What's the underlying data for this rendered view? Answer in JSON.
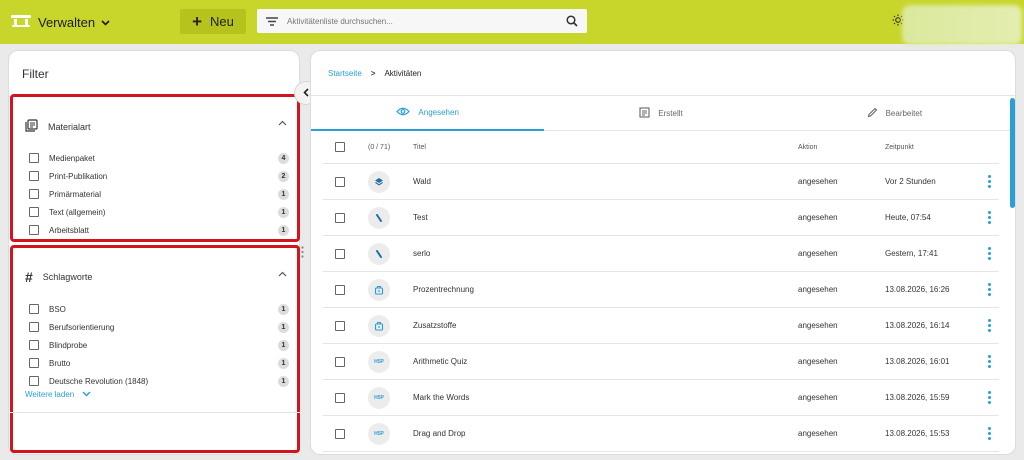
{
  "header": {
    "brand_label": "Verwalten",
    "new_button_label": "Neu",
    "search_placeholder": "Aktivitätenliste durchsuchen...",
    "accent_color": "#c8d62b"
  },
  "filter_panel": {
    "title": "Filter",
    "material_type": {
      "label": "Materialart",
      "items": [
        {
          "label": "Medienpaket",
          "count": "4"
        },
        {
          "label": "Print-Publikation",
          "count": "2"
        },
        {
          "label": "Primärmaterial",
          "count": "1"
        },
        {
          "label": "Text (allgemein)",
          "count": "1"
        },
        {
          "label": "Arbeitsblatt",
          "count": "1"
        }
      ]
    },
    "keywords": {
      "label": "Schlagworte",
      "items": [
        {
          "label": "BSO",
          "count": "1"
        },
        {
          "label": "Berufsorientierung",
          "count": "1"
        },
        {
          "label": "Blindprobe",
          "count": "1"
        },
        {
          "label": "Brutto",
          "count": "1"
        },
        {
          "label": "Deutsche Revolution (1848)",
          "count": "1"
        }
      ],
      "load_more": "Weitere laden"
    }
  },
  "breadcrumb": {
    "home": "Startseite",
    "separator": ">",
    "current": "Aktivitäten"
  },
  "tabs": [
    {
      "label": "Angesehen",
      "icon": "eye-icon",
      "active": true
    },
    {
      "label": "Erstellt",
      "icon": "edit-document-icon",
      "active": false
    },
    {
      "label": "Bearbeitet",
      "icon": "pencil-icon",
      "active": false
    }
  ],
  "table": {
    "columns": {
      "count": "(0 / 71)",
      "title": "Titel",
      "action": "Aktion",
      "time": "Zeitpunkt"
    },
    "rows": [
      {
        "icon": "layers-icon",
        "title": "Wald",
        "action": "angesehen",
        "time": "Vor 2 Stunden"
      },
      {
        "icon": "link-icon",
        "title": "Test",
        "action": "angesehen",
        "time": "Heute, 07:54"
      },
      {
        "icon": "link-icon",
        "title": "serlo",
        "action": "angesehen",
        "time": "Gestern, 17:41"
      },
      {
        "icon": "package-icon",
        "title": "Prozentrechnung",
        "action": "angesehen",
        "time": "13.08.2026, 16:26"
      },
      {
        "icon": "package-icon",
        "title": "Zusatzstoffe",
        "action": "angesehen",
        "time": "13.08.2026, 16:14"
      },
      {
        "icon": "h5p-icon",
        "title": "Arithmetic Quiz",
        "action": "angesehen",
        "time": "13.08.2026, 16:01"
      },
      {
        "icon": "h5p-icon",
        "title": "Mark the Words",
        "action": "angesehen",
        "time": "13.08.2026, 15:59"
      },
      {
        "icon": "h5p-icon",
        "title": "Drag and Drop",
        "action": "angesehen",
        "time": "13.08.2026, 15:53"
      }
    ]
  },
  "h5p_badge": "H5P"
}
